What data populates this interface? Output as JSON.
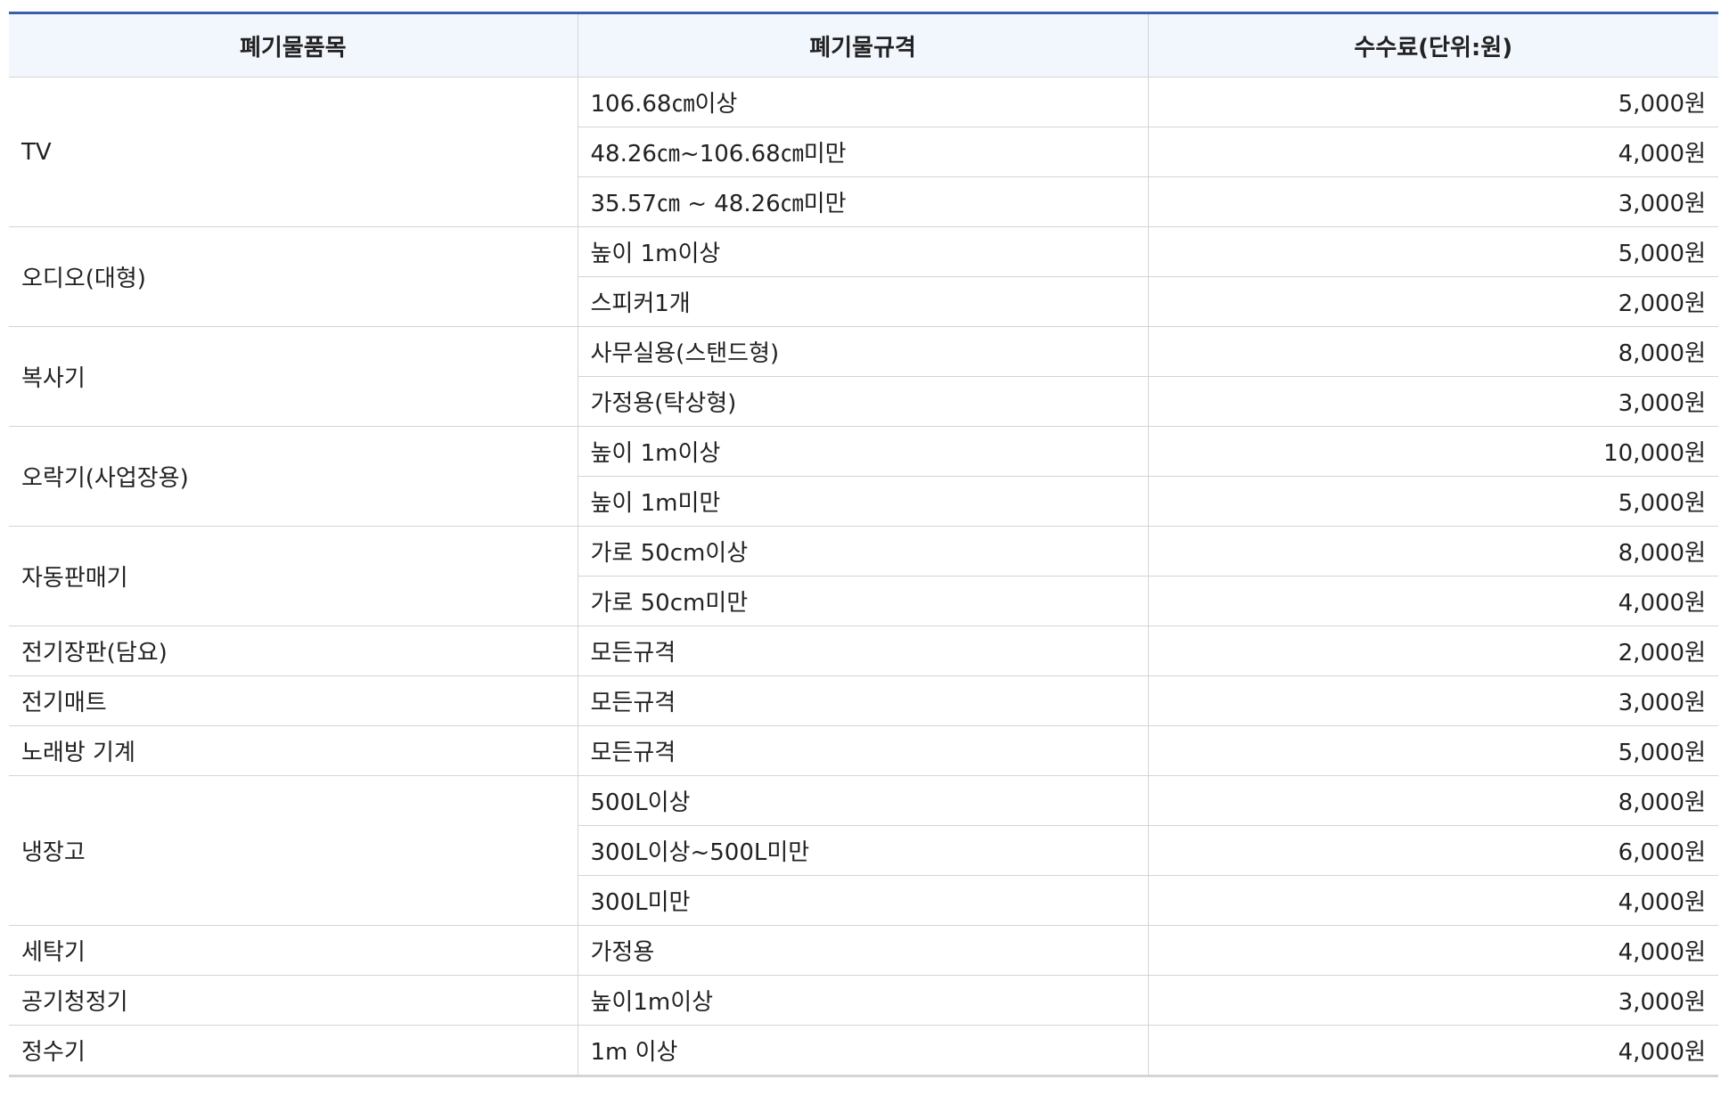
{
  "table": {
    "headers": [
      "폐기물품목",
      "폐기물규격",
      "수수료(단위:원)"
    ],
    "groups": [
      {
        "item": "TV",
        "rows": [
          {
            "spec": "106.68㎝이상",
            "fee": "5,000원"
          },
          {
            "spec": "48.26㎝~106.68㎝미만",
            "fee": "4,000원"
          },
          {
            "spec": "35.57㎝ ~ 48.26㎝미만",
            "fee": "3,000원"
          }
        ]
      },
      {
        "item": "오디오(대형)",
        "rows": [
          {
            "spec": "높이 1m이상",
            "fee": "5,000원"
          },
          {
            "spec": "스피커1개",
            "fee": "2,000원"
          }
        ]
      },
      {
        "item": "복사기",
        "rows": [
          {
            "spec": "사무실용(스탠드형)",
            "fee": "8,000원"
          },
          {
            "spec": "가정용(탁상형)",
            "fee": "3,000원"
          }
        ]
      },
      {
        "item": "오락기(사업장용)",
        "rows": [
          {
            "spec": "높이 1m이상",
            "fee": "10,000원"
          },
          {
            "spec": "높이 1m미만",
            "fee": "5,000원"
          }
        ]
      },
      {
        "item": "자동판매기",
        "rows": [
          {
            "spec": "가로 50cm이상",
            "fee": "8,000원"
          },
          {
            "spec": "가로 50cm미만",
            "fee": "4,000원"
          }
        ]
      },
      {
        "item": "전기장판(담요)",
        "rows": [
          {
            "spec": "모든규격",
            "fee": "2,000원"
          }
        ]
      },
      {
        "item": "전기매트",
        "rows": [
          {
            "spec": "모든규격",
            "fee": "3,000원"
          }
        ]
      },
      {
        "item": "노래방 기계",
        "rows": [
          {
            "spec": "모든규격",
            "fee": "5,000원"
          }
        ]
      },
      {
        "item": "냉장고",
        "rows": [
          {
            "spec": "500L이상",
            "fee": "8,000원"
          },
          {
            "spec": "300L이상~500L미만",
            "fee": "6,000원"
          },
          {
            "spec": "300L미만",
            "fee": "4,000원"
          }
        ]
      },
      {
        "item": "세탁기",
        "rows": [
          {
            "spec": "가정용",
            "fee": "4,000원"
          }
        ]
      },
      {
        "item": "공기청정기",
        "rows": [
          {
            "spec": "높이1m이상",
            "fee": "3,000원"
          }
        ]
      },
      {
        "item": "정수기",
        "rows": [
          {
            "spec": "1m 이상",
            "fee": "4,000원"
          }
        ]
      }
    ]
  },
  "colors": {
    "header_background": "#f2f6fd",
    "top_border": "#3a5ea8",
    "grid_line": "#d4d4d4",
    "text": "#222222"
  }
}
